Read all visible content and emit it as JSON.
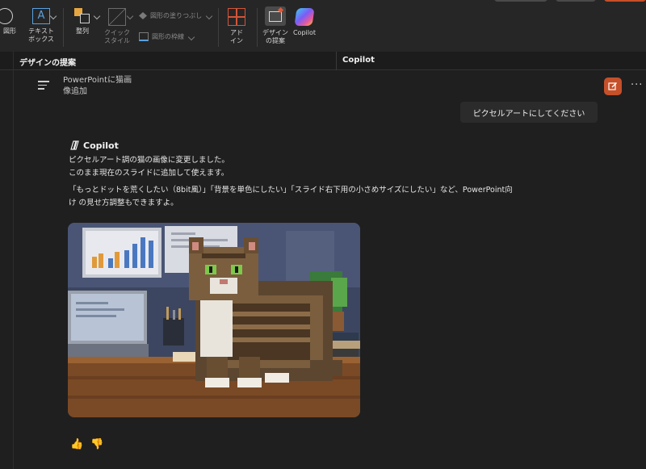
{
  "ribbon": {
    "shapes_label": "図形",
    "textbox_label": "テキスト\nボックス",
    "arrange_label": "整列",
    "quick_style_label": "クイック\nスタイル",
    "shape_fill_label": "図形の塗りつぶし",
    "shape_outline_label": "図形の枠線",
    "addins_label": "アド\nイン",
    "designer_label": "デザイン\nの提案",
    "copilot_label": "Copilot"
  },
  "panes": {
    "design_title": "デザインの提案",
    "copilot_title": "Copilot"
  },
  "conversation": {
    "title_line1": "PowerPointに猫画",
    "title_line2": "像追加",
    "more": "···"
  },
  "user_message": "ピクセルアートにしてください",
  "assistant": {
    "name": "Copilot",
    "line1": "ピクセルアート調の猫の画像に変更しました。",
    "line2": "このまま現在のスライドに追加して使えます。",
    "line3": "「もっとドットを荒くしたい（8bit風）」「背景を単色にしたい」「スライド右下用の小さめサイズにしたい」など、PowerPoint向",
    "line4": "け の見せ方調整もできますよ。"
  },
  "feedback": {
    "like": "👍",
    "dislike": "👎"
  },
  "colors": {
    "accent": "#c5502a",
    "background": "#1f1f1f",
    "ribbon": "#262626"
  }
}
